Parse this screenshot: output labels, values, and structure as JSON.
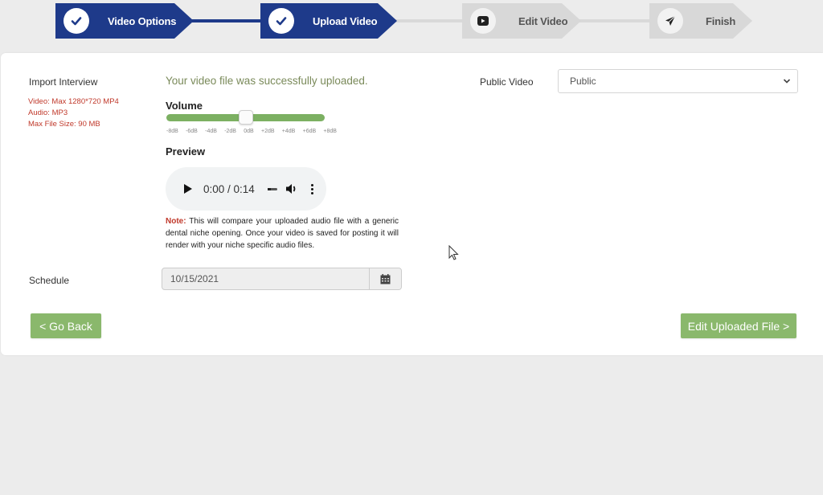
{
  "stepper": {
    "steps": [
      {
        "label": "Video Options",
        "status": "complete",
        "icon": "check-icon"
      },
      {
        "label": "Upload Video",
        "status": "complete",
        "icon": "check-icon"
      },
      {
        "label": "Edit Video",
        "status": "pending",
        "icon": "video-play-icon"
      },
      {
        "label": "Finish",
        "status": "pending",
        "icon": "paper-plane-icon"
      }
    ]
  },
  "import": {
    "label": "Import Interview",
    "requirements": [
      "Video: Max 1280*720 MP4",
      "Audio: MP3",
      "Max File Size: 90 MB"
    ]
  },
  "upload": {
    "success_message": "Your video file was successfully uploaded."
  },
  "volume": {
    "label": "Volume",
    "value_db": 0,
    "ticks": [
      "-8dB",
      "-6dB",
      "-4dB",
      "-2dB",
      "0dB",
      "+2dB",
      "+4dB",
      "+6dB",
      "+8dB"
    ]
  },
  "preview": {
    "label": "Preview",
    "time": "0:00 / 0:14"
  },
  "note": {
    "label": "Note:",
    "text": " This will compare your uploaded audio file with a generic dental niche opening. Once your video is saved for posting it will render with your niche specific audio files."
  },
  "public_video": {
    "label": "Public Video",
    "selected": "Public"
  },
  "schedule": {
    "label": "Schedule",
    "date": "10/15/2021"
  },
  "buttons": {
    "back": "< Go Back",
    "next": "Edit Uploaded File >"
  },
  "colors": {
    "step_done": "#1e3a8a",
    "step_todo": "#d8d8d8",
    "accent_green": "#8ab86c",
    "requirement_red": "#c0392b"
  }
}
